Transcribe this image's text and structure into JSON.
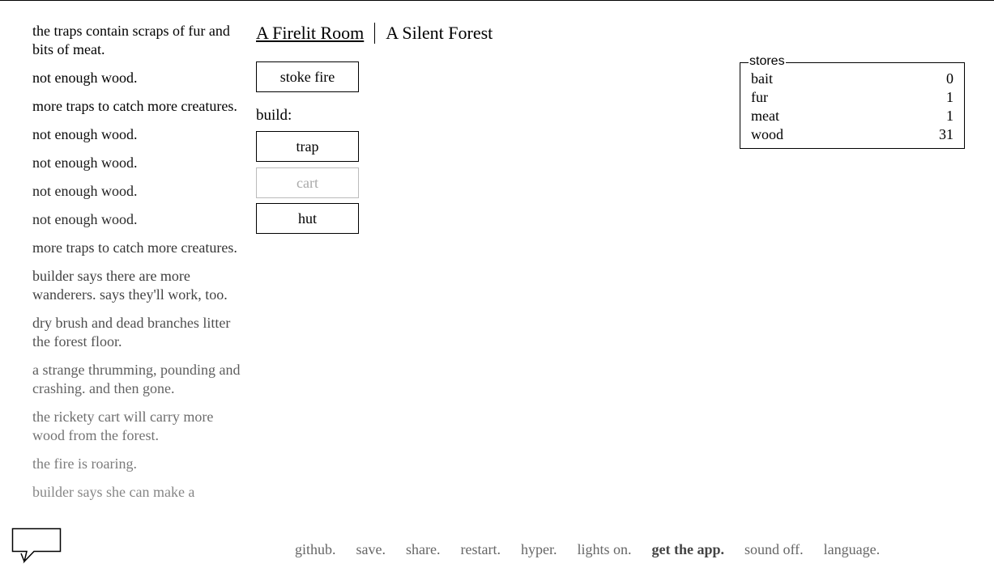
{
  "notifications": [
    "the traps contain scraps of fur and bits of meat.",
    "not enough wood.",
    "more traps to catch more creatures.",
    "not enough wood.",
    "not enough wood.",
    "not enough wood.",
    "not enough wood.",
    "more traps to catch more creatures.",
    "builder says there are more wanderers. says they'll work, too.",
    "dry brush and dead branches litter the forest floor.",
    "a strange thrumming, pounding and crashing. and then gone.",
    "the rickety cart will carry more wood from the forest.",
    "the fire is roaring.",
    "builder says she can make a"
  ],
  "header": {
    "room_tab": "A Firelit Room",
    "forest_tab": "A Silent Forest"
  },
  "actions": {
    "stoke_fire": "stoke fire",
    "build_label": "build:",
    "trap": "trap",
    "cart": "cart",
    "hut": "hut"
  },
  "stores": {
    "legend": "stores",
    "items": [
      {
        "name": "bait",
        "value": "0"
      },
      {
        "name": "fur",
        "value": "1"
      },
      {
        "name": "meat",
        "value": "1"
      },
      {
        "name": "wood",
        "value": "31"
      }
    ]
  },
  "footer": {
    "github": "github.",
    "save": "save.",
    "share": "share.",
    "restart": "restart.",
    "hyper": "hyper.",
    "lights": "lights on.",
    "app": "get the app.",
    "sound": "sound off.",
    "language": "language."
  }
}
